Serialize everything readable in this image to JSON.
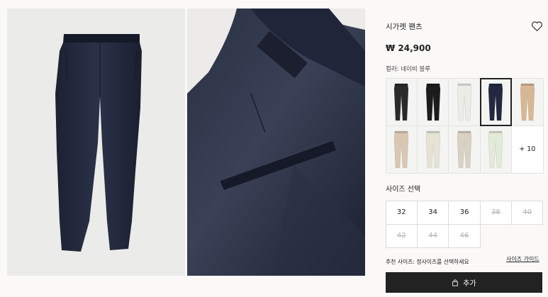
{
  "product": {
    "title": "시가렛 팬츠",
    "price": "₩ 24,900",
    "color_label": "컬러: 네이비 블루"
  },
  "gallery": {
    "image1_icon": "navy-trousers-front-photo",
    "image2_icon": "navy-trousers-pocket-closeup-photo"
  },
  "colors": {
    "swatches": [
      {
        "name": "black-trousers",
        "color": "#2a2a2a"
      },
      {
        "name": "black-trousers-2",
        "color": "#1c1c1c"
      },
      {
        "name": "white-trousers",
        "color": "#ecebe5"
      },
      {
        "name": "navy-trousers",
        "color": "#232840",
        "selected": true
      },
      {
        "name": "beige-trousers",
        "color": "#d8b794"
      },
      {
        "name": "light-beige-trousers",
        "color": "#d9c7b1"
      },
      {
        "name": "cream-trousers",
        "color": "#e5e2d6"
      },
      {
        "name": "sand-trousers",
        "color": "#d9d2c4"
      },
      {
        "name": "mint-trousers",
        "color": "#e3ead8"
      }
    ],
    "more_label": "+ 10"
  },
  "size_section": {
    "label": "사이즈 선택",
    "sizes": [
      {
        "label": "32",
        "available": true
      },
      {
        "label": "34",
        "available": true
      },
      {
        "label": "36",
        "available": true
      },
      {
        "label": "38",
        "available": false
      },
      {
        "label": "40",
        "available": false
      },
      {
        "label": "42",
        "available": false
      },
      {
        "label": "44",
        "available": false
      },
      {
        "label": "46",
        "available": false
      }
    ],
    "recommendation": "추천 사이즈: 정사이즈를 선택하세요",
    "guide_link": "사이즈 가이드"
  },
  "cart": {
    "button_label": "추가",
    "icon": "shopping-bag-icon"
  },
  "theme": {
    "accent": "#222222",
    "unavailable": "#b3b3b3"
  }
}
